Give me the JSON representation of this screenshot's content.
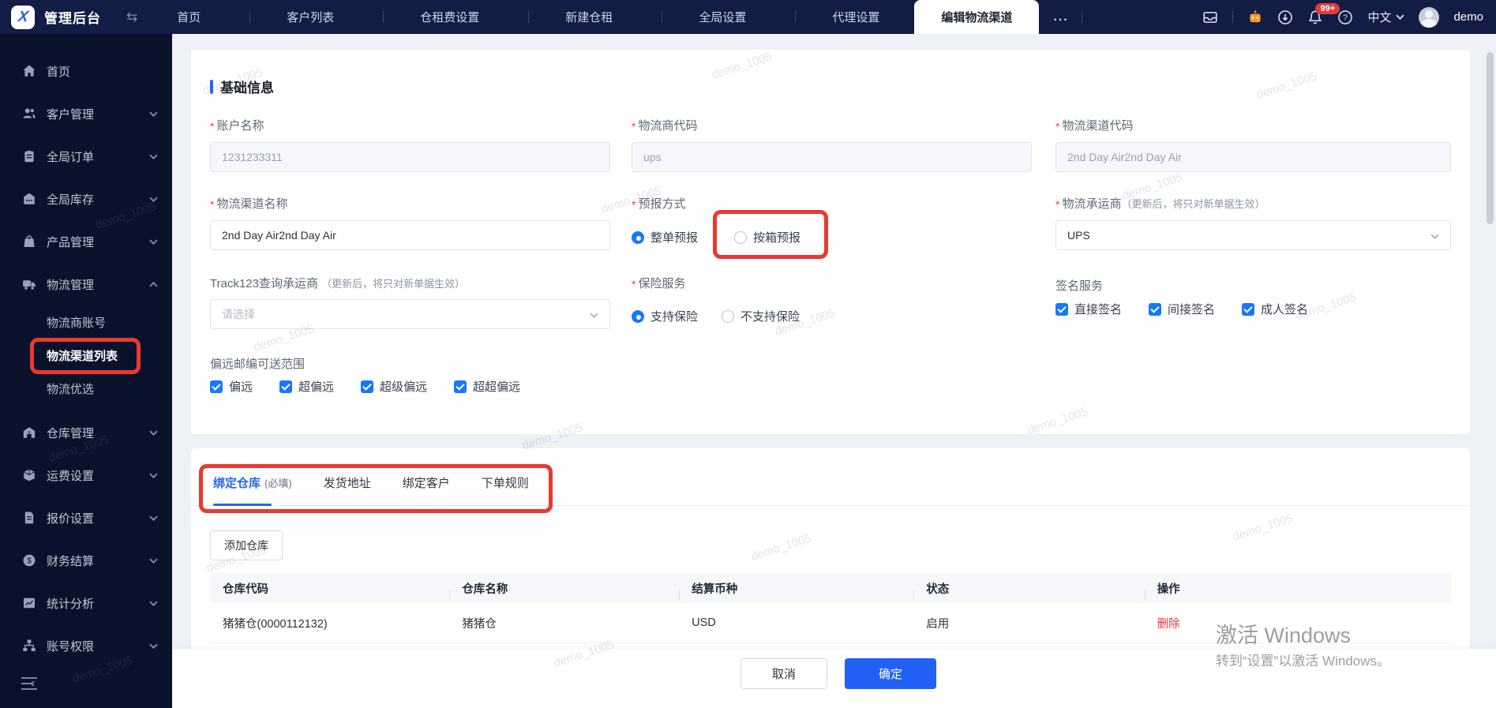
{
  "topbar": {
    "title": "管理后台",
    "tabs": [
      "首页",
      "客户列表",
      "仓租费设置",
      "新建仓租",
      "全局设置",
      "代理设置"
    ],
    "active_tab": "编辑物流渠道",
    "more": "...",
    "badge": "99+",
    "language": "中文",
    "user": "demo"
  },
  "sidebar": {
    "items": [
      {
        "icon": "home-icon",
        "label": "首页"
      },
      {
        "icon": "customers-icon",
        "label": "客户管理"
      },
      {
        "icon": "orders-icon",
        "label": "全局订单"
      },
      {
        "icon": "inventory-icon",
        "label": "全局库存"
      },
      {
        "icon": "products-icon",
        "label": "产品管理"
      },
      {
        "icon": "logistics-icon",
        "label": "物流管理",
        "children": [
          "物流商账号",
          "物流渠道列表",
          "物流优选"
        ],
        "active_child": "物流渠道列表"
      },
      {
        "icon": "warehouse-icon",
        "label": "仓库管理"
      },
      {
        "icon": "freight-icon",
        "label": "运费设置"
      },
      {
        "icon": "quote-icon",
        "label": "报价设置"
      },
      {
        "icon": "finance-icon",
        "label": "财务结算"
      },
      {
        "icon": "stats-icon",
        "label": "统计分析"
      },
      {
        "icon": "account-icon",
        "label": "账号权限"
      }
    ]
  },
  "form": {
    "section_title": "基础信息",
    "fields": {
      "account_name": {
        "label": "账户名称",
        "value": "1231233311"
      },
      "provider_code": {
        "label": "物流商代码",
        "value": "ups"
      },
      "channel_code": {
        "label": "物流渠道代码",
        "value": "2nd Day Air2nd Day Air"
      },
      "channel_name": {
        "label": "物流渠道名称",
        "value": "2nd Day Air2nd Day Air"
      },
      "forecast": {
        "label": "预报方式",
        "options": [
          "整单预报",
          "按箱预报"
        ],
        "selected": "整单预报"
      },
      "carrier": {
        "label": "物流承运商",
        "note": "（更新后，将只对新单据生效）",
        "value": "UPS"
      },
      "track123": {
        "label": "Track123查询承运商",
        "note": "（更新后，将只对新单据生效）",
        "placeholder": "请选择"
      },
      "insurance": {
        "label": "保险服务",
        "options": [
          "支持保险",
          "不支持保险"
        ],
        "selected": "支持保险"
      },
      "signature": {
        "label": "签名服务",
        "options": [
          "直接签名",
          "间接签名",
          "成人签名"
        ],
        "checked": [
          true,
          true,
          true
        ]
      },
      "remote": {
        "label": "偏远邮编可送范围",
        "options": [
          "偏远",
          "超偏远",
          "超级偏远",
          "超超偏远"
        ],
        "checked": [
          true,
          true,
          true,
          true
        ]
      }
    }
  },
  "tabs_section": {
    "tabs": [
      {
        "label": "绑定仓库",
        "suffix": "(必填)",
        "active": true
      },
      {
        "label": "发货地址"
      },
      {
        "label": "绑定客户"
      },
      {
        "label": "下单规则"
      }
    ],
    "add_button": "添加仓库",
    "table": {
      "headers": [
        "仓库代码",
        "仓库名称",
        "结算币种",
        "状态",
        "操作"
      ],
      "rows": [
        {
          "code": "猪猪仓(0000112132)",
          "name": "猪猪仓",
          "currency": "USD",
          "status": "启用",
          "action": "删除"
        }
      ]
    }
  },
  "footer": {
    "cancel": "取消",
    "confirm": "确定"
  },
  "watermark": {
    "text": "demo_1005"
  },
  "windows_watermark": {
    "line1": "激活 Windows",
    "line2": "转到“设置”以激活 Windows。"
  },
  "colors": {
    "accent": "#2563eb",
    "check_blue": "#1677ff",
    "annotation_red": "#e83a30",
    "delete_red": "#e8383d",
    "topbar_bg": "#131c45",
    "sidebar_bg": "#0a122b"
  }
}
